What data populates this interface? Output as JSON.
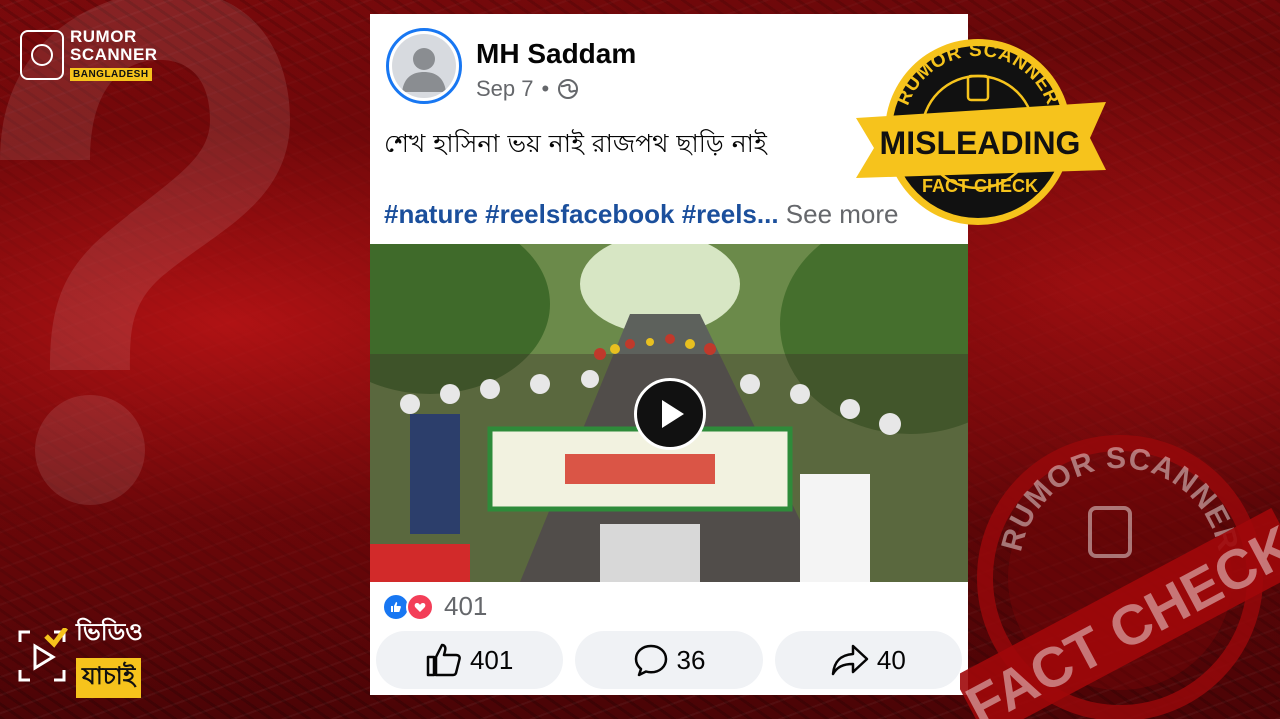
{
  "brand_logo": {
    "line1": "RUMOR",
    "line2": "SCANNER",
    "line3": "BANGLADESH"
  },
  "post": {
    "author": "MH Saddam",
    "date": "Sep 7",
    "separator": "•",
    "caption": "শেখ হাসিনা ভয় নাই রাজপথ ছাড়ি নাই",
    "hashtags": "#nature #reelsfacebook #reels...",
    "see_more": " See more",
    "reaction_count": "401",
    "actions": {
      "like_count": "401",
      "comment_count": "36",
      "share_count": "40"
    }
  },
  "stamp_misleading": {
    "top": "RUMOR SCANNER",
    "label": "MISLEADING",
    "bottom": "FACT CHECK"
  },
  "stamp_factcheck": {
    "top": "RUMOR SCANNER",
    "label": "FACT CHECK"
  },
  "video_brand": {
    "line1": "ভিডিও",
    "line2": "যাচাই"
  },
  "colors": {
    "accent_yellow": "#f6c31c",
    "fb_blue": "#1877f2",
    "bg_red": "#7a0a0c"
  }
}
